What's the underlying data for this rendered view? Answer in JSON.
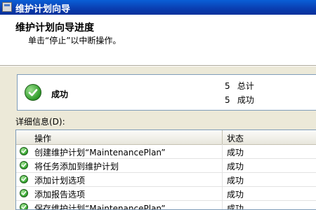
{
  "window": {
    "title": "维护计划向导"
  },
  "header": {
    "title": "维护计划向导进度",
    "subtitle": "单击“停止”以中断操作。"
  },
  "summary": {
    "status": "成功",
    "total_count": "5",
    "total_label": "总计",
    "success_count": "5",
    "success_label": "成功"
  },
  "details": {
    "label": "详细信息(D):",
    "columns": {
      "operation": "操作",
      "status": "状态"
    },
    "rows": [
      {
        "operation": "创建维护计划“MaintenancePlan”",
        "status": "成功"
      },
      {
        "operation": "将任务添加到维护计划",
        "status": "成功"
      },
      {
        "operation": "添加计划选项",
        "status": "成功"
      },
      {
        "operation": "添加报告选项",
        "status": "成功"
      },
      {
        "operation": "保存维护计划“MaintenancePlan”",
        "status": "成功"
      }
    ]
  },
  "colors": {
    "titlebar": "#0a3db0",
    "success_green": "#2f9a2a"
  },
  "icons": {
    "status": "success-check-icon"
  }
}
